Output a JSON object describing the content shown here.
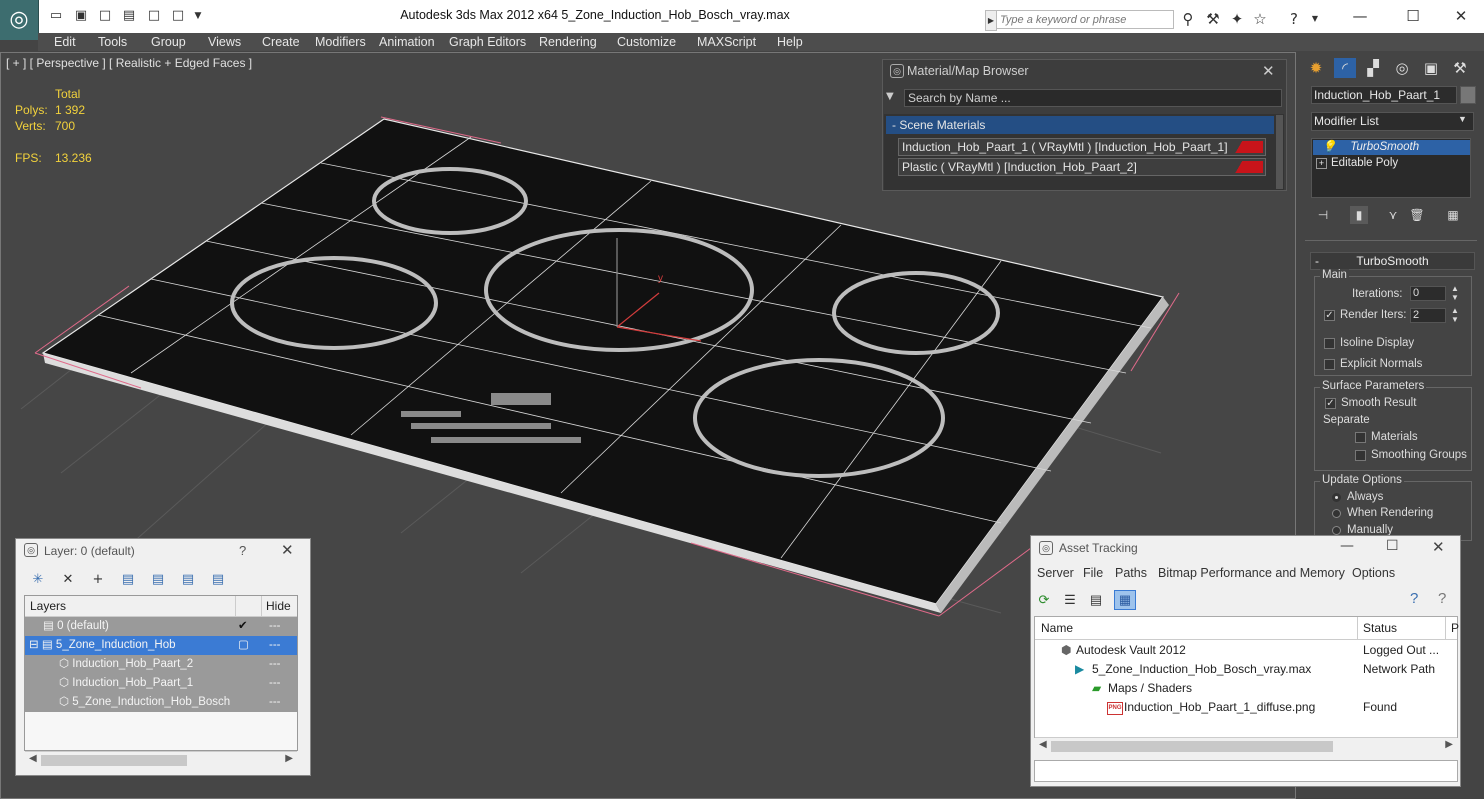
{
  "title_bar": {
    "app_title": "Autodesk 3ds Max  2012 x64      5_Zone_Induction_Hob_Bosch_vray.max",
    "search_placeholder": "Type a keyword or phrase",
    "quick_access_icons": [
      "open-icon",
      "save-icon",
      "new-icon",
      "project-icon",
      "undo-icon",
      "redo-icon",
      "dropdown-icon"
    ]
  },
  "menu": {
    "items": [
      "Edit",
      "Tools",
      "Group",
      "Views",
      "Create",
      "Modifiers",
      "Animation",
      "Graph Editors",
      "Rendering",
      "Customize",
      "MAXScript",
      "Help"
    ]
  },
  "viewport": {
    "label": "[ + ] [ Perspective ] [ Realistic + Edged Faces ]",
    "stats": {
      "total_label": "Total",
      "polys_label": "Polys:",
      "polys_value": "1 392",
      "verts_label": "Verts:",
      "verts_value": "700",
      "fps_label": "FPS:",
      "fps_value": "13.236"
    },
    "gizmo_label": "y"
  },
  "material_browser": {
    "title": "Material/Map Browser",
    "search_placeholder": "Search by Name ...",
    "group_label": "- Scene Materials",
    "materials": [
      "Induction_Hob_Paart_1  ( VRayMtl )  [Induction_Hob_Paart_1]",
      "Plastic  ( VRayMtl )  [Induction_Hob_Paart_2]"
    ],
    "swatch_color": "#c8141a"
  },
  "command_panel": {
    "object_name": "Induction_Hob_Paart_1",
    "modifier_list_label": "Modifier List",
    "stack": [
      "TurboSmooth",
      "Editable Poly"
    ],
    "rollout_title": "TurboSmooth",
    "main": {
      "group_label": "Main",
      "iterations_label": "Iterations:",
      "iterations_value": "0",
      "render_iters_label": "Render Iters:",
      "render_iters_value": "2",
      "isoline_label": "Isoline Display",
      "explicit_normals_label": "Explicit Normals"
    },
    "surface": {
      "group_label": "Surface Parameters",
      "smooth_result_label": "Smooth Result",
      "separate_label": "Separate",
      "materials_label": "Materials",
      "smoothing_groups_label": "Smoothing Groups"
    },
    "update": {
      "group_label": "Update Options",
      "always_label": "Always",
      "when_rendering_label": "When Rendering",
      "manually_label": "Manually"
    }
  },
  "layer_dialog": {
    "title": "Layer: 0 (default)",
    "help": "?",
    "column_layers": "Layers",
    "column_hide": "Hide",
    "rows": [
      {
        "name": "0 (default)"
      },
      {
        "name": "5_Zone_Induction_Hob"
      },
      {
        "name": "Induction_Hob_Paart_2"
      },
      {
        "name": "Induction_Hob_Paart_1"
      },
      {
        "name": "5_Zone_Induction_Hob_Bosch"
      }
    ]
  },
  "asset_tracking": {
    "title": "Asset Tracking",
    "menu": [
      "Server",
      "File",
      "Paths",
      "Bitmap Performance and Memory",
      "Options"
    ],
    "column_name": "Name",
    "column_status": "Status",
    "column_p": "P",
    "rows": [
      {
        "name": "Autodesk Vault 2012",
        "status": "Logged Out ..."
      },
      {
        "name": "5_Zone_Induction_Hob_Bosch_vray.max",
        "status": "Network Path"
      },
      {
        "name": "Maps / Shaders",
        "status": ""
      },
      {
        "name": "Induction_Hob_Paart_1_diffuse.png",
        "status": "Found"
      }
    ],
    "file_badge": "PNG"
  }
}
